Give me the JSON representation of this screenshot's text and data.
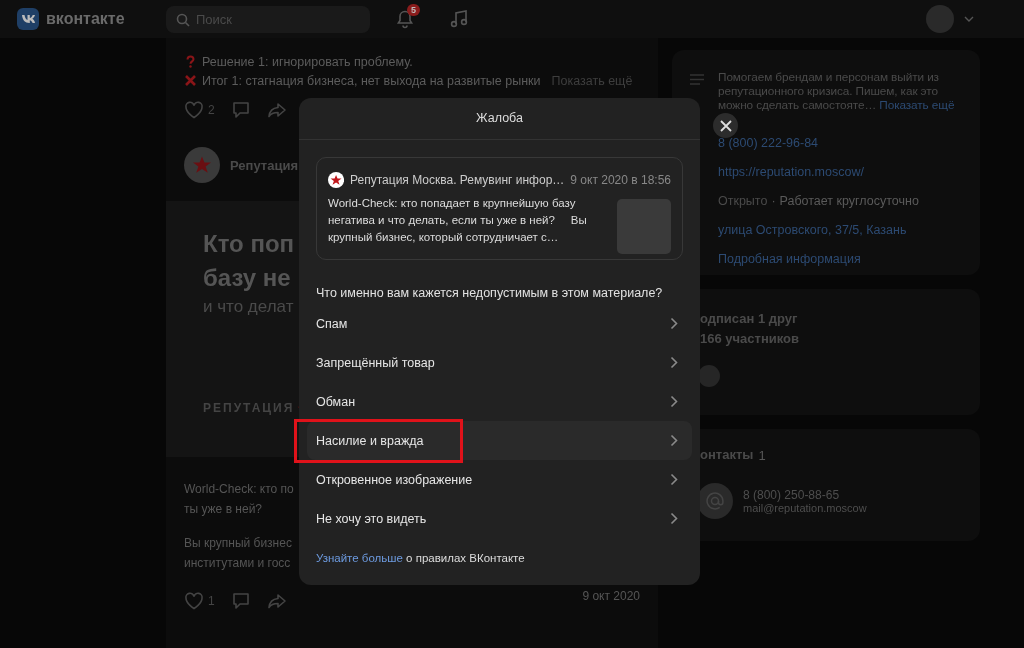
{
  "header": {
    "logo_text": "вконтакте",
    "search": {
      "placeholder": "Поиск"
    },
    "notifications_badge": "5"
  },
  "feed": {
    "post_top": {
      "lines": [
        {
          "kind": "question",
          "text": "Решение 1: игнорировать проблему."
        },
        {
          "kind": "cross",
          "text": "Итог 1: стагнация бизнеса, нет выхода на развитые рынки"
        }
      ],
      "more_link": "Показать ещё",
      "likes": "2"
    },
    "post": {
      "author": "Репутация",
      "article_title_lines": [
        "Кто поп",
        "базу не"
      ],
      "article_subtitle": "и что делат",
      "article_brand": "РЕПУТАЦИЯ",
      "text_paragraphs": [
        [
          "World-Check: кто по",
          "ты уже в ней?"
        ],
        [
          "Вы крупный бизнес",
          "институтами и госс"
        ]
      ],
      "likes": "1",
      "date": "9 окт 2020"
    }
  },
  "sidebar": {
    "about": {
      "description": "Помогаем брендам и персонам выйти из репутационного кризиса. Пишем, как это можно сделать самостояте…",
      "more_link": "Показать ещё",
      "items": [
        {
          "kind": "link",
          "text": "8 (800) 222-96-84"
        },
        {
          "kind": "link",
          "text": "https://reputation.moscow/"
        },
        {
          "kind": "status",
          "label": "Открыто",
          "separator": "·",
          "text": "Работает круглосуточно"
        },
        {
          "kind": "link",
          "text": "улица Островского, 37/5, Казань"
        },
        {
          "kind": "link",
          "text": "Подробная информация"
        }
      ]
    },
    "members": {
      "friends": "одписан 1 друг",
      "count": "166 участников"
    },
    "contacts": {
      "title": "онтакты",
      "count": "1",
      "phone": "8 (800) 250-88-65",
      "email": "mail@reputation.moscow"
    }
  },
  "modal": {
    "title": "Жалоба",
    "preview": {
      "author": "Репутация Москва. Ремувинг инфор…",
      "date": "9 окт 2020 в 18:56",
      "text": "World-Check: кто попадает в крупнейшую базу негатива и что делать, если ты уже в ней?     Вы крупный бизнес, который сотрудничает с…"
    },
    "question": "Что именно вам кажется недопустимым в этом материале?",
    "options": [
      {
        "label": "Спам",
        "hovered": false,
        "marked": false
      },
      {
        "label": "Запрещённый товар",
        "hovered": false,
        "marked": false
      },
      {
        "label": "Обман",
        "hovered": false,
        "marked": false
      },
      {
        "label": "Насилие и вражда",
        "hovered": true,
        "marked": true
      },
      {
        "label": "Откровенное изображение",
        "hovered": false,
        "marked": false
      },
      {
        "label": "Не хочу это видеть",
        "hovered": false,
        "marked": false
      }
    ],
    "footer": {
      "link": "Узнайте больше",
      "text": "о правилах ВКонтакте"
    }
  }
}
